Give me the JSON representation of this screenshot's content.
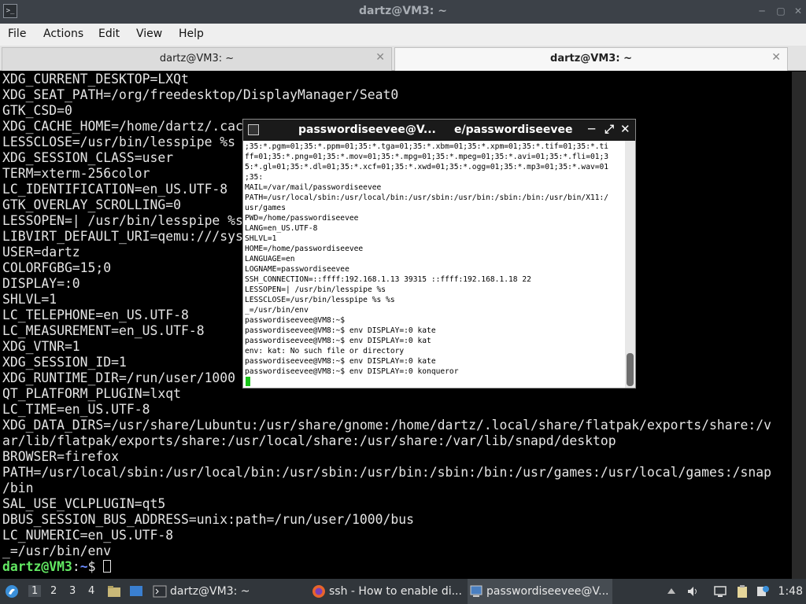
{
  "window": {
    "title": "dartz@VM3: ~",
    "minimize_glyph": "─",
    "maximize_glyph": "▢",
    "close_glyph": "✕"
  },
  "menu": [
    "File",
    "Actions",
    "Edit",
    "View",
    "Help"
  ],
  "tabs": [
    {
      "label": "dartz@VM3: ~",
      "active": false
    },
    {
      "label": "dartz@VM3: ~",
      "active": true
    }
  ],
  "terminal": {
    "lines": [
      "XDG_CURRENT_DESKTOP=LXQt",
      "XDG_SEAT_PATH=/org/freedesktop/DisplayManager/Seat0",
      "GTK_CSD=0",
      "XDG_CACHE_HOME=/home/dartz/.cac",
      "LESSCLOSE=/usr/bin/lesspipe %s",
      "XDG_SESSION_CLASS=user",
      "TERM=xterm-256color",
      "LC_IDENTIFICATION=en_US.UTF-8",
      "GTK_OVERLAY_SCROLLING=0",
      "LESSOPEN=| /usr/bin/lesspipe %s",
      "LIBVIRT_DEFAULT_URI=qemu:///sys",
      "USER=dartz",
      "COLORFGBG=15;0",
      "DISPLAY=:0",
      "SHLVL=1",
      "LC_TELEPHONE=en_US.UTF-8",
      "LC_MEASUREMENT=en_US.UTF-8",
      "XDG_VTNR=1",
      "XDG_SESSION_ID=1",
      "XDG_RUNTIME_DIR=/run/user/1000",
      "QT_PLATFORM_PLUGIN=lxqt",
      "LC_TIME=en_US.UTF-8",
      "XDG_DATA_DIRS=/usr/share/Lubuntu:/usr/share/gnome:/home/dartz/.local/share/flatpak/exports/share:/v",
      "ar/lib/flatpak/exports/share:/usr/local/share:/usr/share:/var/lib/snapd/desktop",
      "BROWSER=firefox",
      "PATH=/usr/local/sbin:/usr/local/bin:/usr/sbin:/usr/bin:/sbin:/bin:/usr/games:/usr/local/games:/snap",
      "/bin",
      "SAL_USE_VCLPLUGIN=qt5",
      "DBUS_SESSION_BUS_ADDRESS=unix:path=/run/user/1000/bus",
      "LC_NUMERIC=en_US.UTF-8",
      "_=/usr/bin/env"
    ],
    "prompt_user": "dartz@VM3",
    "prompt_sep": ":",
    "prompt_path": "~",
    "prompt_symbol": "$ "
  },
  "xterm": {
    "title_left": "passwordiseevee@V...",
    "title_right": "e/passwordiseevee",
    "btn_min": "─",
    "btn_max": "⤢",
    "btn_close": "✕",
    "lines": [
      ";35:*.pgm=01;35:*.ppm=01;35:*.tga=01;35:*.xbm=01;35:*.xpm=01;35:*.tif=01;35:*.ti",
      "ff=01;35:*.png=01;35:*.mov=01;35:*.mpg=01;35:*.mpeg=01;35:*.avi=01;35:*.fli=01;3",
      "5:*.gl=01;35:*.dl=01;35:*.xcf=01;35:*.xwd=01;35:*.ogg=01;35:*.mp3=01;35:*.wav=01",
      ";35:",
      "MAIL=/var/mail/passwordiseevee",
      "PATH=/usr/local/sbin:/usr/local/bin:/usr/sbin:/usr/bin:/sbin:/bin:/usr/bin/X11:/",
      "usr/games",
      "PWD=/home/passwordiseevee",
      "LANG=en_US.UTF-8",
      "SHLVL=1",
      "HOME=/home/passwordiseevee",
      "LANGUAGE=en",
      "LOGNAME=passwordiseevee",
      "SSH_CONNECTION=::ffff:192.168.1.13 39315 ::ffff:192.168.1.18 22",
      "LESSOPEN=| /usr/bin/lesspipe %s",
      "LESSCLOSE=/usr/bin/lesspipe %s %s",
      "_=/usr/bin/env",
      "passwordiseevee@VM8:~$",
      "passwordiseevee@VM8:~$ env DISPLAY=:0 kate",
      "passwordiseevee@VM8:~$ env DISPLAY=:0 kat",
      "env: kat: No such file or directory",
      "passwordiseevee@VM8:~$ env DISPLAY=:0 kate",
      "passwordiseevee@VM8:~$ env DISPLAY=:0 konqueror"
    ]
  },
  "taskbar": {
    "workspaces": [
      "1",
      "2",
      "3",
      "4"
    ],
    "tasks": [
      {
        "label": "dartz@VM3: ~"
      },
      {
        "label": "ssh - How to enable di..."
      },
      {
        "label": "passwordiseevee@V..."
      }
    ],
    "clock": "1:48"
  }
}
